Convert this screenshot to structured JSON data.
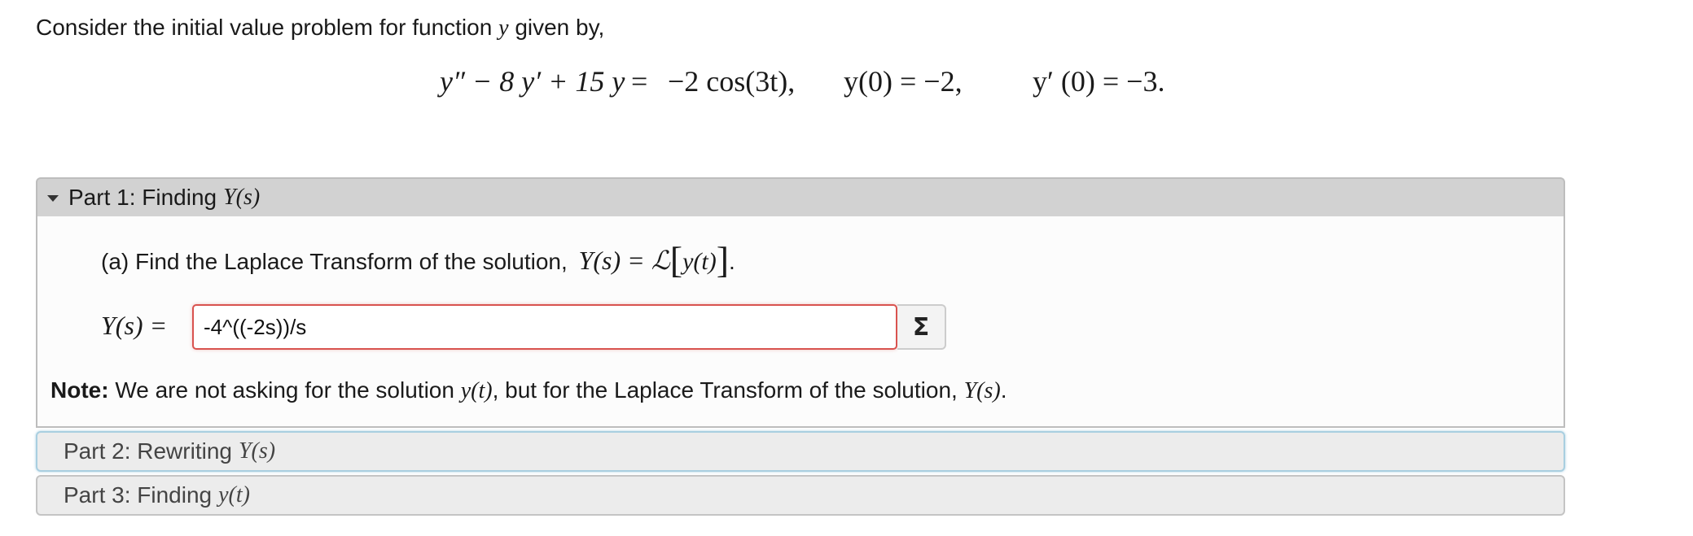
{
  "problem": {
    "intro": "Consider the initial value problem for function",
    "intro_var": "y",
    "intro_end": "given by,",
    "ode": {
      "lhs": "y″ − 8 y′ + 15 y",
      "equals": "=",
      "rhs": "−2 cos(3t),"
    },
    "ic1": "y(0) = −2,",
    "ic2": "y′ (0) = −3."
  },
  "parts": [
    {
      "label": "Part 1: Finding",
      "math": "Y(s)",
      "expanded": true,
      "question": {
        "prefix": "(a) Find the Laplace Transform of the solution,",
        "math_lhs": "Y(s) = ℒ",
        "bracket_open": "[",
        "math_inner": "y(t)",
        "bracket_close": "]",
        "suffix": "."
      },
      "answer": {
        "label": "Y(s) =",
        "value": "-4^((-2s))/s",
        "sigma_label": "Σ"
      },
      "note": {
        "bold": "Note:",
        "text1": "We are not asking for the solution",
        "math1": "y(t)",
        "text2": ", but for the Laplace Transform of the solution,",
        "math2": "Y(s)",
        "text3": "."
      }
    },
    {
      "label": "Part 2: Rewriting",
      "math": "Y(s)",
      "expanded": false
    },
    {
      "label": "Part 3: Finding",
      "math": "y(t)",
      "expanded": false
    }
  ],
  "colors": {
    "input_error_border": "#d9534f",
    "part1_header_bg": "#d2d2d2",
    "focused_header_border": "#a9cfe0"
  }
}
